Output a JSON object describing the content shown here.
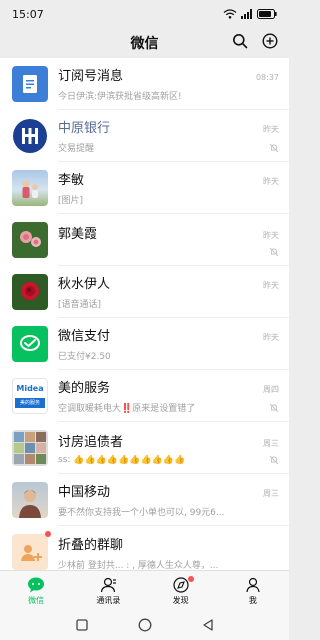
{
  "status": {
    "time": "15:07",
    "battery": "85"
  },
  "header": {
    "title": "微信"
  },
  "chats": [
    {
      "name": "订阅号消息",
      "time": "08:37",
      "message": "今日伊滨:伊滨获批省级高新区!",
      "muted": false,
      "official": false
    },
    {
      "name": "中原银行",
      "time": "昨天",
      "message": "交易提醒",
      "muted": true,
      "official": true
    },
    {
      "name": "李敏",
      "time": "昨天",
      "message": "[图片]",
      "muted": false,
      "official": false
    },
    {
      "name": "郭美霞",
      "time": "昨天",
      "message": "",
      "muted": true,
      "official": false
    },
    {
      "name": "秋水伊人",
      "time": "昨天",
      "message": "[语音通话]",
      "muted": false,
      "official": false
    },
    {
      "name": "微信支付",
      "time": "昨天",
      "message": "已支付¥2.50",
      "muted": false,
      "official": false
    },
    {
      "name": "美的服务",
      "time": "周四",
      "message": "空调取暖耗电大‼️原来是设置错了",
      "muted": true,
      "official": false
    },
    {
      "name": "讨房追债者",
      "time": "周三",
      "message": "ss: 👍👍👍👍👍👍👍👍👍👍",
      "muted": true,
      "official": false
    },
    {
      "name": "中国移动",
      "time": "周三",
      "message": "要不然你支持我一个小单也可以, 99元6...",
      "muted": false,
      "official": false
    },
    {
      "name": "折叠的群聊",
      "time": "",
      "message": "少林前 登封共... : , 厚德人生众人尊，...",
      "muted": false,
      "official": false
    }
  ],
  "avatar_labels": {
    "midea_top": "Midea",
    "midea_bottom": "美的服务"
  },
  "tabs": [
    {
      "label": "微信",
      "active": true
    },
    {
      "label": "通讯录",
      "active": false
    },
    {
      "label": "发现",
      "active": false
    },
    {
      "label": "我",
      "active": false
    }
  ],
  "colors": {
    "accent": "#07c160",
    "official_name": "#576b95",
    "badge": "#fa5151"
  }
}
